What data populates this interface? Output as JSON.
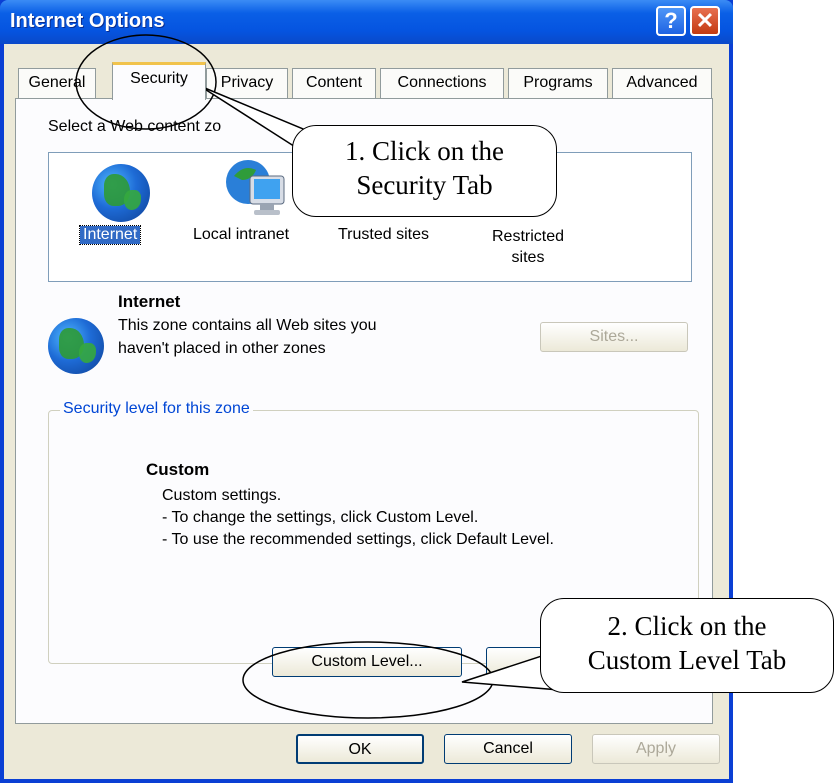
{
  "window": {
    "title": "Internet Options"
  },
  "tabs": [
    "General",
    "Security",
    "Privacy",
    "Content",
    "Connections",
    "Programs",
    "Advanced"
  ],
  "zones": {
    "heading": "Select a Web content zo",
    "items": [
      {
        "label": "Internet",
        "icon": "globe-icon"
      },
      {
        "label": "Local intranet",
        "icon": "local-intranet-icon"
      },
      {
        "label": "Trusted sites",
        "icon": "trusted-sites-icon"
      },
      {
        "label": "Restricted\nsites",
        "icon": "restricted-sites-icon"
      }
    ]
  },
  "zone_info": {
    "title": "Internet",
    "description_line1": "This zone contains all Web sites you",
    "description_line2": "haven't placed in other zones",
    "sites_button": "Sites..."
  },
  "security_level": {
    "legend": "Security level for this zone",
    "title": "Custom",
    "line1": "Custom settings.",
    "line2": "- To change the settings, click Custom Level.",
    "line3": "- To use the recommended settings, click Default Level.",
    "custom_level_button": "Custom Level..."
  },
  "footer": {
    "ok": "OK",
    "cancel": "Cancel",
    "apply": "Apply"
  },
  "callouts": {
    "step1_line1": "1. Click on the",
    "step1_line2": "Security Tab",
    "step2_line1": "2. Click on the",
    "step2_line2": "Custom Level Tab"
  },
  "colors": {
    "title_bar": "#0554e0",
    "accent_tab": "#f1c34c",
    "link_blue": "#0046d5",
    "dialog_bg": "#ece9d8"
  }
}
